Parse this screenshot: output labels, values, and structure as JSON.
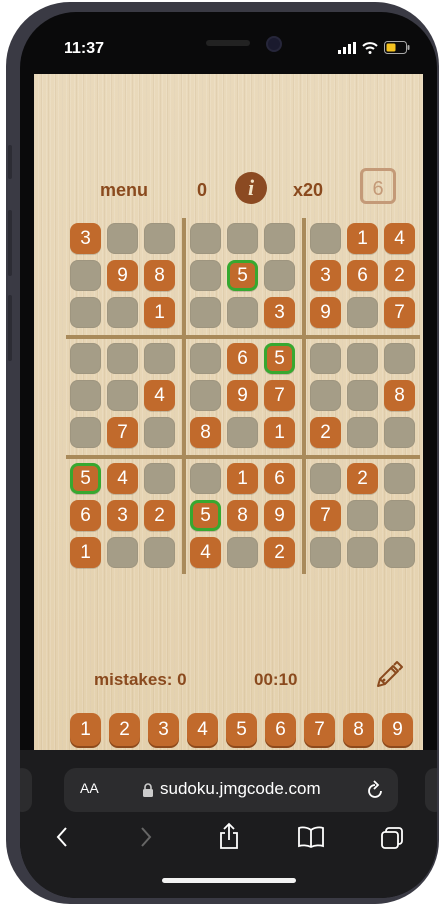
{
  "status_bar": {
    "time": "11:37"
  },
  "game": {
    "menu_label": "menu",
    "score": "0",
    "info_label": "i",
    "multiplier": "x20",
    "hint_count": "6",
    "mistakes_label": "mistakes: 0",
    "timer": "00:10",
    "grid": [
      [
        "3",
        "",
        "",
        "",
        "",
        "",
        "",
        "1",
        "4"
      ],
      [
        "",
        "9",
        "8",
        "",
        "5",
        "",
        "3",
        "6",
        "2"
      ],
      [
        "",
        "",
        "1",
        "",
        "",
        "3",
        "9",
        "",
        "7"
      ],
      [
        "",
        "",
        "",
        "",
        "6",
        "5",
        "",
        "",
        ""
      ],
      [
        "",
        "",
        "4",
        "",
        "9",
        "7",
        "",
        "",
        "8"
      ],
      [
        "",
        "7",
        "",
        "8",
        "",
        "1",
        "2",
        "",
        ""
      ],
      [
        "5",
        "4",
        "",
        "",
        "1",
        "6",
        "",
        "2",
        ""
      ],
      [
        "6",
        "3",
        "2",
        "5",
        "8",
        "9",
        "7",
        "",
        ""
      ],
      [
        "1",
        "",
        "",
        "4",
        "",
        "2",
        "",
        "",
        ""
      ]
    ],
    "highlighted_cells": [
      [
        1,
        4
      ],
      [
        3,
        5
      ],
      [
        6,
        0
      ],
      [
        7,
        3
      ]
    ],
    "numpad": [
      "1",
      "2",
      "3",
      "4",
      "5",
      "6",
      "7",
      "8",
      "9"
    ],
    "colors": {
      "tile": "#c16a2c",
      "empty_tile": "#a59d87",
      "highlight": "#37a830",
      "background": "#e6d4b3",
      "text": "#8a4a1e"
    }
  },
  "browser": {
    "text_size_label": "AA",
    "url": "sudoku.jmgcode.com"
  },
  "icons": {
    "info": "info-icon",
    "pencil": "pencil-icon",
    "lock": "lock-icon",
    "reload": "reload-icon",
    "back": "back-icon",
    "forward": "forward-icon",
    "share": "share-icon",
    "bookmarks": "bookmarks-icon",
    "tabs": "tabs-icon",
    "signal": "signal-icon",
    "wifi": "wifi-icon",
    "battery": "battery-icon"
  }
}
